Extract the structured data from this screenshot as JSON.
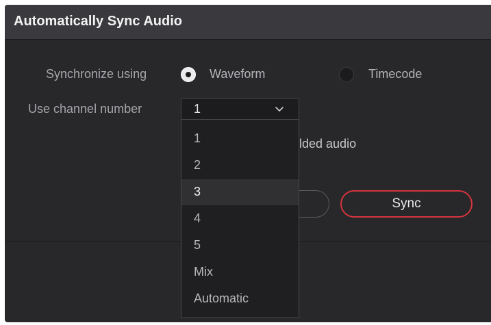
{
  "dialog": {
    "title": "Automatically Sync Audio"
  },
  "sync": {
    "label": "Synchronize using",
    "options": [
      {
        "label": "Waveform",
        "selected": true
      },
      {
        "label": "Timecode",
        "selected": false
      }
    ]
  },
  "channel": {
    "label": "Use channel number",
    "selected": "1",
    "options": [
      "1",
      "2",
      "3",
      "4",
      "5",
      "Mix",
      "Automatic"
    ],
    "highlighted": "3"
  },
  "embedded_text_fragment": "lded audio",
  "buttons": {
    "sync_label": "Sync"
  },
  "colors": {
    "dialog_bg": "#28282b",
    "titlebar_bg": "#3a3a3e",
    "accent_red": "#d6343d",
    "highlight_bg": "#303033"
  },
  "icons": {
    "select_arrow": "chevron-down-icon"
  }
}
